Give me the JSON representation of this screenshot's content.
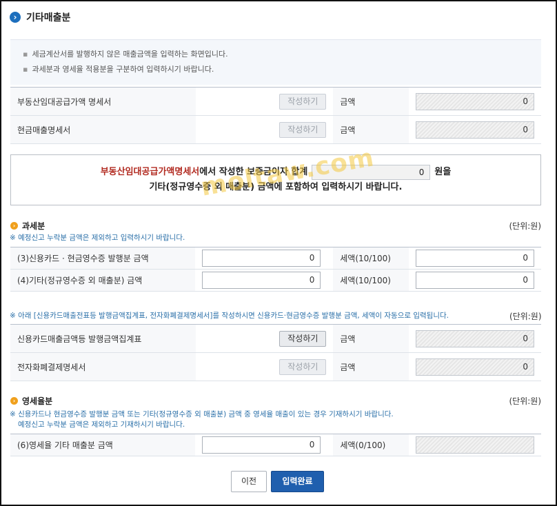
{
  "page": {
    "title": "기타매출분",
    "title_icon": "arrow-circle-icon"
  },
  "info": {
    "lines": [
      "세금계산서를 발행하지 않은 매출금액을 입력하는 화면입니다.",
      "과세분과 영세율 적용분을 구분하여 입력하시기 바랍니다."
    ]
  },
  "statements": [
    {
      "label": "부동산임대공급가액 명세서",
      "button": "작성하기",
      "button_enabled": false,
      "amount_label": "금액",
      "amount": "0"
    },
    {
      "label": "현금매출명세서",
      "button": "작성하기",
      "button_enabled": false,
      "amount_label": "금액",
      "amount": "0"
    }
  ],
  "notice": {
    "red_text": "부동산임대공급가액명세서",
    "text1": "에서 작성한 보증금이자 합계",
    "value": "0",
    "unit": "원을",
    "text2": "기타(정규영수증 외 매출분) 금액에 포함하여 입력하시기 바랍니다."
  },
  "watermark": "moltaw.com",
  "taxable": {
    "title": "과세분",
    "unit": "(단위:원)",
    "note": "※ 예정신고 누락분 금액은 제외하고 입력하시기 바랍니다.",
    "rows": [
      {
        "label": "(3)신용카드 · 현금영수증 발행분 금액",
        "value": "0",
        "tax_label": "세액(10/100)",
        "tax": "0"
      },
      {
        "label": "(4)기타(정규영수증 외 매출분) 금액",
        "value": "0",
        "tax_label": "세액(10/100)",
        "tax": "0"
      }
    ]
  },
  "auto_section": {
    "note": "※ 아래 [신용카드매출전표등 발행금액집계표, 전자화폐결제명세서]를 작성하시면 신용카드·현금영수증 발행분 금액, 세액이 자동으로 입력됩니다.",
    "unit": "(단위:원)",
    "rows": [
      {
        "label": "신용카드매출금액등 발행금액집계표",
        "button": "작성하기",
        "button_enabled": true,
        "amount_label": "금액",
        "amount": "0"
      },
      {
        "label": "전자화폐결제명세서",
        "button": "작성하기",
        "button_enabled": false,
        "amount_label": "금액",
        "amount": "0"
      }
    ]
  },
  "zero_rate": {
    "title": "영세율분",
    "unit": "(단위:원)",
    "note1": "※ 신용카드나 현금영수증 발행분 금액 또는 기타(정규영수증 외 매출분) 금액 중 영세율 매출이 있는 경우 기재하시기 바랍니다.",
    "note2": "예정신고 누락분 금액은 제외하고 기재하시기 바랍니다.",
    "row": {
      "label": "(6)영세율 기타 매출분 금액",
      "value": "0",
      "tax_label": "세액(0/100)",
      "tax": ""
    }
  },
  "buttons": {
    "prev": "이전",
    "done": "입력완료"
  },
  "colors": {
    "primary": "#1f5fae",
    "accent_red": "#b22b21",
    "section_icon": "#f0a01d",
    "note_blue": "#2a6fa8"
  }
}
